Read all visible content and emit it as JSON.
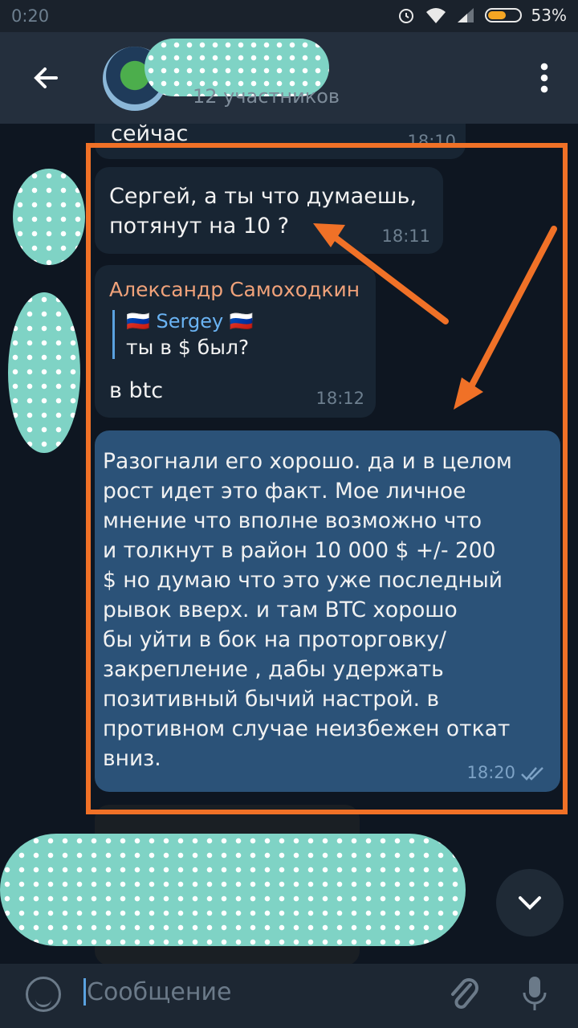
{
  "status_bar": {
    "time": "0:20",
    "battery_percent": "53%"
  },
  "header": {
    "subtitle": "12 участников"
  },
  "messages": [
    {
      "partial_text": "сейчас",
      "time": "18:10"
    },
    {
      "text_line1": "Сергей, а ты что думаешь,",
      "text_line2": "потянут на 10 ?",
      "time": "18:11"
    },
    {
      "sender": "Александр Самоходкин",
      "reply_name": "🇷🇺 Sergey 🇷🇺",
      "reply_text": "ты в $ был?",
      "text": "в btc",
      "time": "18:12"
    },
    {
      "lines": [
        "Разогнали его хорошо. да и в целом",
        "рост идет это факт. Мое личное",
        "мнение что вполне возможно что",
        "и толкнут в район 10 000 $ +/- 200",
        "$ но думаю что это уже последный",
        "рывок вверх. и там BTC хорошо",
        "бы уйти в бок на проторговку/",
        "закрепление , дабы удержать",
        "позитивный бычий настрой. в",
        "противном случае неизбежен откат",
        "вниз."
      ],
      "time": "18:20"
    }
  ],
  "composer": {
    "placeholder": "Сообщение"
  },
  "colors": {
    "highlight": "#f07127",
    "outgoing_bubble": "#2b5278",
    "incoming_bubble": "#182533"
  },
  "icons": [
    "back-arrow-icon",
    "more-vert-icon",
    "scroll-down-icon",
    "emoji-icon",
    "attach-icon",
    "mic-icon",
    "double-check-icon",
    "wifi-icon",
    "alarm-icon",
    "signal-icon",
    "battery-icon"
  ]
}
